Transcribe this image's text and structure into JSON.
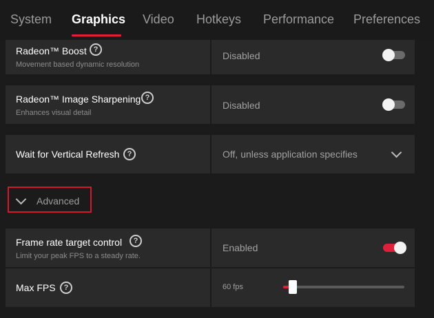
{
  "tabs": [
    {
      "label": "System",
      "active": false
    },
    {
      "label": "Graphics",
      "active": true
    },
    {
      "label": "Video",
      "active": false
    },
    {
      "label": "Hotkeys",
      "active": false
    },
    {
      "label": "Performance",
      "active": false
    },
    {
      "label": "Preferences",
      "active": false
    }
  ],
  "settings": {
    "boost": {
      "title": "Radeon™ Boost",
      "subtitle": "Movement based dynamic resolution",
      "value": "Disabled",
      "enabled": false
    },
    "sharpening": {
      "title": "Radeon™ Image Sharpening",
      "subtitle": "Enhances visual detail",
      "value": "Disabled",
      "enabled": false
    },
    "vsync": {
      "title": "Wait for Vertical Refresh",
      "value": "Off, unless application specifies"
    },
    "advanced": {
      "label": "Advanced"
    },
    "frtc": {
      "title": "Frame rate target control",
      "subtitle": "Limit your peak FPS to a steady rate.",
      "value": "Enabled",
      "enabled": true
    },
    "maxfps": {
      "title": "Max FPS",
      "value": "60 fps",
      "level": 0.08
    }
  },
  "colors": {
    "accent": "#e0203a",
    "highlight_border": "#d5182b"
  }
}
